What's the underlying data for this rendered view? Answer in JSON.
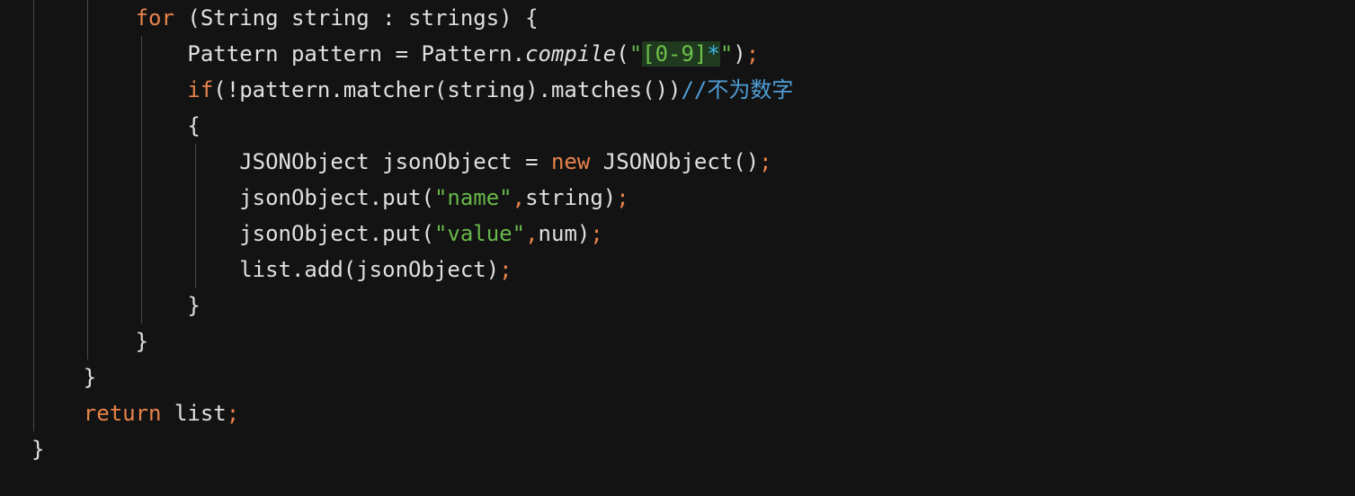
{
  "editor": {
    "lines": [
      [
        {
          "t": "        ",
          "c": ""
        },
        {
          "t": "for",
          "c": "kw"
        },
        {
          "t": " (String string : strings) {",
          "c": ""
        }
      ],
      [
        {
          "t": "            Pattern pattern = Pattern.",
          "c": ""
        },
        {
          "t": "compile",
          "c": "italic"
        },
        {
          "t": "(",
          "c": ""
        },
        {
          "t": "\"",
          "c": "str"
        },
        {
          "t": "[0-9]",
          "c": "rx-class rx-bg"
        },
        {
          "t": "*",
          "c": "rx-star rx-bg"
        },
        {
          "t": "\"",
          "c": "str"
        },
        {
          "t": ")",
          "c": ""
        },
        {
          "t": ";",
          "c": "punct"
        }
      ],
      [
        {
          "t": "            ",
          "c": ""
        },
        {
          "t": "if",
          "c": "kw"
        },
        {
          "t": "(!pattern.matcher(string).matches())",
          "c": ""
        },
        {
          "t": "//不为数字",
          "c": "cmt"
        }
      ],
      [
        {
          "t": "            {",
          "c": ""
        }
      ],
      [
        {
          "t": "                JSONObject jsonObject = ",
          "c": ""
        },
        {
          "t": "new",
          "c": "kw"
        },
        {
          "t": " JSONObject()",
          "c": ""
        },
        {
          "t": ";",
          "c": "punct"
        }
      ],
      [
        {
          "t": "                jsonObject.put(",
          "c": ""
        },
        {
          "t": "\"name\"",
          "c": "str"
        },
        {
          "t": ",",
          "c": "punct"
        },
        {
          "t": "string)",
          "c": ""
        },
        {
          "t": ";",
          "c": "punct"
        }
      ],
      [
        {
          "t": "                jsonObject.put(",
          "c": ""
        },
        {
          "t": "\"value\"",
          "c": "str"
        },
        {
          "t": ",",
          "c": "punct"
        },
        {
          "t": "num)",
          "c": ""
        },
        {
          "t": ";",
          "c": "punct"
        }
      ],
      [
        {
          "t": "                list.add(jsonObject)",
          "c": ""
        },
        {
          "t": ";",
          "c": "punct"
        }
      ],
      [
        {
          "t": "            }",
          "c": ""
        }
      ],
      [
        {
          "t": "        }",
          "c": ""
        }
      ],
      [
        {
          "t": "    }",
          "c": ""
        }
      ],
      [
        {
          "t": "    ",
          "c": ""
        },
        {
          "t": "return",
          "c": "kw"
        },
        {
          "t": " list",
          "c": ""
        },
        {
          "t": ";",
          "c": "punct"
        }
      ],
      [
        {
          "t": "}",
          "c": ""
        }
      ]
    ]
  },
  "colors": {
    "background": "#131313",
    "keyword": "#e8834a",
    "string": "#68b84a",
    "comment": "#4f9ed6",
    "regex_star": "#3fb4e8",
    "text": "#e0e0e0"
  }
}
